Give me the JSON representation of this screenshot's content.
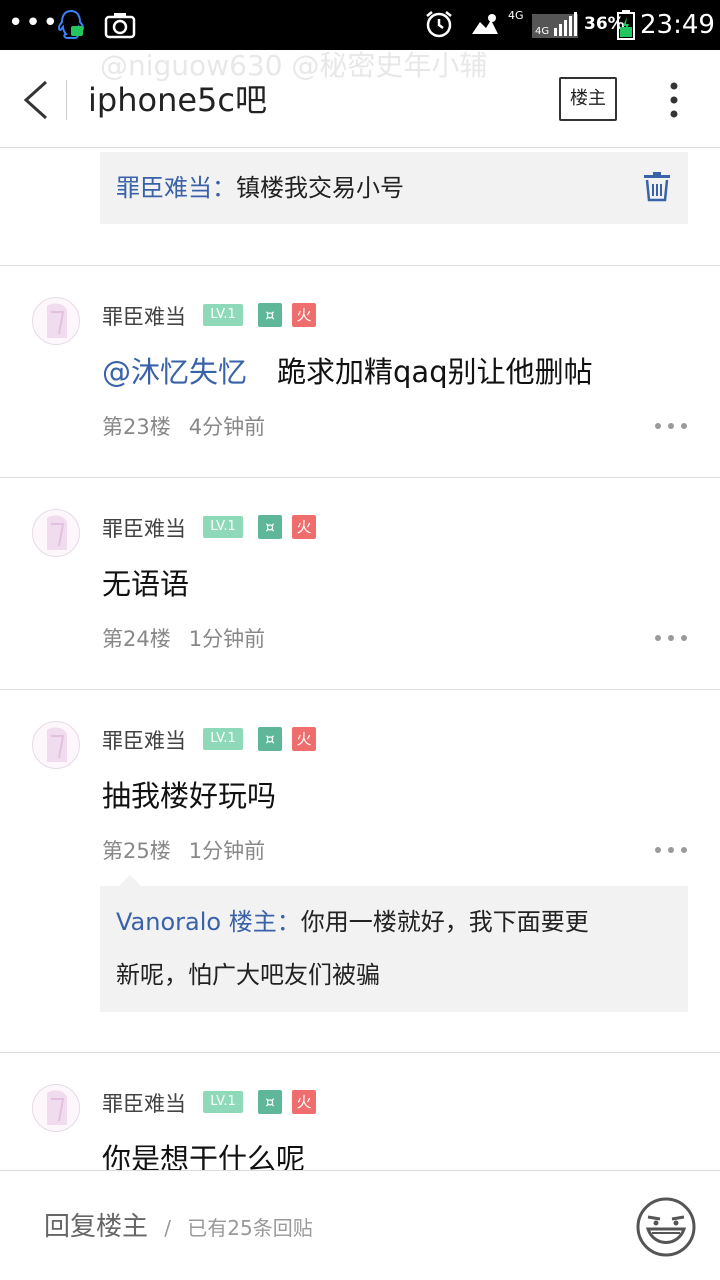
{
  "status_bar": {
    "dots": "•••",
    "network": "4G",
    "battery_percent": "36%",
    "time": "23:49",
    "icons": [
      "qq-icon",
      "camera-icon",
      "alarm-icon",
      "weather-icon",
      "signal-icon",
      "battery-icon"
    ]
  },
  "header": {
    "title": "iphone5c吧",
    "owner_only_label": "楼主",
    "ghost_line1": "@niguow630   @秘密史年小辅",
    "ghost_line2": ""
  },
  "top_quote": {
    "name": "罪臣难当：",
    "text": "镇楼我交易小号"
  },
  "posts": [
    {
      "username": "罪臣难当",
      "level": "LV.1",
      "badge_m": "¤",
      "badge_fire": "火",
      "mention": "@沐忆失忆",
      "text": "跪求加精qaq别让他删帖",
      "floor": "第23楼",
      "time": "4分钟前"
    },
    {
      "username": "罪臣难当",
      "level": "LV.1",
      "badge_m": "¤",
      "badge_fire": "火",
      "text": "无语语",
      "floor": "第24楼",
      "time": "1分钟前"
    },
    {
      "username": "罪臣难当",
      "level": "LV.1",
      "badge_m": "¤",
      "badge_fire": "火",
      "text": "抽我楼好玩吗",
      "floor": "第25楼",
      "time": "1分钟前",
      "reply": {
        "name": "Vanoralo 楼主：",
        "text_line1": "你用一楼就好，我下面要更",
        "text_line2": "新呢，怕广大吧友们被骗"
      }
    },
    {
      "username": "罪臣难当",
      "level": "LV.1",
      "badge_m": "¤",
      "badge_fire": "火",
      "text": "你是想干什么呢"
    }
  ],
  "bottom_bar": {
    "reply_label": "回复楼主",
    "separator": "/",
    "reply_count": "已有25条回贴"
  },
  "colors": {
    "accent_blue": "#3a62a8",
    "level_badge": "#8ed9b8",
    "fire_badge": "#ef6d6d",
    "member_badge": "#5fb79a"
  }
}
